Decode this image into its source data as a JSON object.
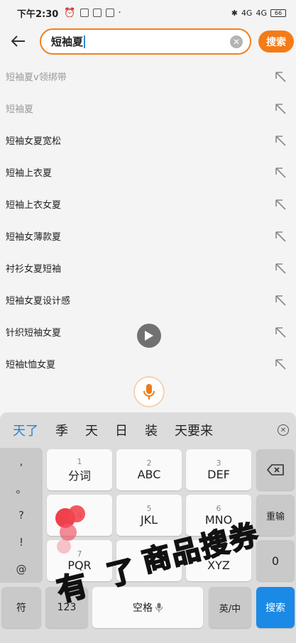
{
  "status": {
    "time": "下午2:30",
    "net1": "4G",
    "net2": "4G",
    "battery": "66"
  },
  "search": {
    "query": "短袖夏",
    "button_label": "搜索"
  },
  "suggestions": [
    {
      "label": "短袖夏v领绑带",
      "faded": true
    },
    {
      "label": "短袖夏",
      "faded": true
    },
    {
      "label": "短袖女夏宽松",
      "faded": false
    },
    {
      "label": "短袖上衣夏",
      "faded": false
    },
    {
      "label": "短袖上衣女夏",
      "faded": false
    },
    {
      "label": "短袖女薄款夏",
      "faded": false
    },
    {
      "label": "衬衫女夏短袖",
      "faded": false
    },
    {
      "label": "短袖女夏设计感",
      "faded": false
    },
    {
      "label": "针织短袖女夏",
      "faded": false
    },
    {
      "label": "短袖t恤女夏",
      "faded": false
    }
  ],
  "keyboard": {
    "candidates": [
      "天了",
      "季",
      "天",
      "日",
      "装",
      "天要来"
    ],
    "punct": [
      ",",
      "。",
      "?",
      "!",
      "@"
    ],
    "keys": [
      {
        "num": "1",
        "let": "分词"
      },
      {
        "num": "2",
        "let": "ABC"
      },
      {
        "num": "3",
        "let": "DEF"
      },
      {
        "num": "4",
        "let": ""
      },
      {
        "num": "5",
        "let": "JKL"
      },
      {
        "num": "6",
        "let": "MNO"
      },
      {
        "num": "7",
        "let": "PQR"
      },
      {
        "num": "8",
        "let": "T"
      },
      {
        "num": "9",
        "let": "XYZ"
      }
    ],
    "delete_icon": "backspace-icon",
    "retype": "重输",
    "zero": "0",
    "symbol": "符",
    "num_key": "123",
    "space": "空格",
    "lang": "英/中",
    "enter": "搜索"
  },
  "overlay": {
    "part1": "有",
    "part2": "了",
    "part3": "商品搜券"
  },
  "colors": {
    "accent": "#f47b17",
    "enter": "#1a8ae6",
    "candidate_highlight": "#2a7fd6"
  }
}
